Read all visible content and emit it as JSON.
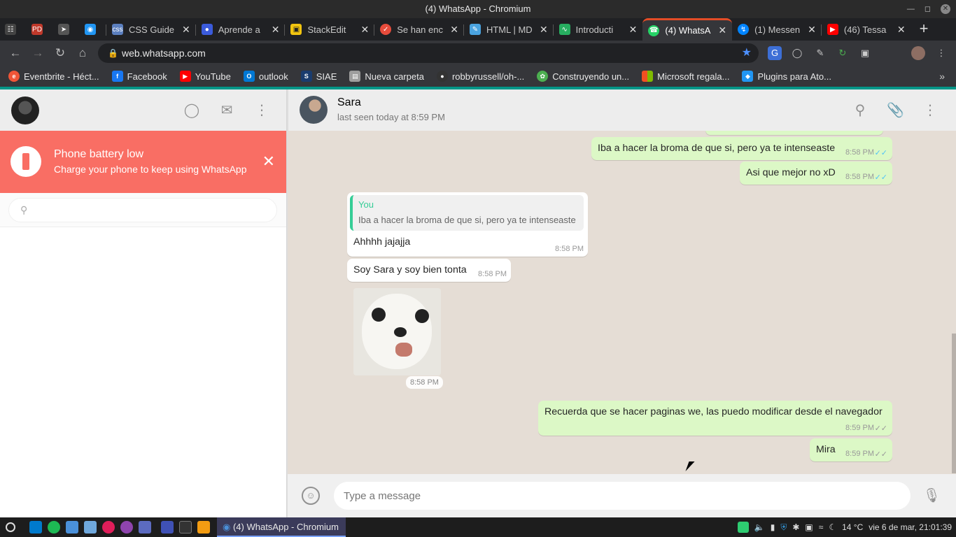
{
  "window": {
    "title": "(4) WhatsApp - Chromium"
  },
  "tabs": [
    {
      "label": "",
      "icon": "library-icon",
      "color": "#444444",
      "pinned": true
    },
    {
      "label": "",
      "icon": "pd-icon",
      "color": "#c0392b",
      "pinned": true
    },
    {
      "label": "",
      "icon": "telegram-icon",
      "color": "#555555",
      "pinned": true
    },
    {
      "label": "",
      "icon": "drop-icon",
      "color": "#2196f3",
      "pinned": true
    },
    {
      "label": "CSS Guide",
      "icon": "css-icon",
      "color": "#5b7fbf"
    },
    {
      "label": "Aprende a",
      "icon": "person-icon",
      "color": "#3b5bdb"
    },
    {
      "label": "StackEdit",
      "icon": "stackedit-icon",
      "color": "#f1c40f"
    },
    {
      "label": "Se han enc",
      "icon": "check-icon",
      "color": "#e74c3c"
    },
    {
      "label": "HTML | MD",
      "icon": "book-icon",
      "color": "#4aa3df"
    },
    {
      "label": "Introducti",
      "icon": "wave-icon",
      "color": "#27ae60"
    },
    {
      "label": "(4) WhatsA",
      "icon": "whatsapp-icon",
      "color": "#25d366",
      "active": true
    },
    {
      "label": "(1) Messen",
      "icon": "messenger-icon",
      "color": "#0084ff"
    },
    {
      "label": "(46) Tessa",
      "icon": "youtube-icon",
      "color": "#ff0000"
    }
  ],
  "address": {
    "url": "web.whatsapp.com"
  },
  "bookmarks": [
    {
      "label": "Eventbrite - Héct...",
      "icon": "eventbrite-icon",
      "color": "#f05537"
    },
    {
      "label": "Facebook",
      "icon": "facebook-icon",
      "color": "#1877f2"
    },
    {
      "label": "YouTube",
      "icon": "youtube-icon",
      "color": "#ff0000"
    },
    {
      "label": "outlook",
      "icon": "outlook-icon",
      "color": "#0078d4"
    },
    {
      "label": "SIAE",
      "icon": "siae-icon",
      "color": "#1a3c6e"
    },
    {
      "label": "Nueva carpeta",
      "icon": "folder-icon",
      "color": "#9e9e9e"
    },
    {
      "label": "robbyrussell/oh-...",
      "icon": "github-icon",
      "color": "#333333"
    },
    {
      "label": "Construyendo un...",
      "icon": "leaf-icon",
      "color": "#4caf50"
    },
    {
      "label": "Microsoft regala...",
      "icon": "microsoft-icon",
      "color": "#f25022"
    },
    {
      "label": "Plugins para Ato...",
      "icon": "plugin-icon",
      "color": "#2196f3"
    }
  ],
  "sidebar": {
    "battery": {
      "title": "Phone battery low",
      "subtitle": "Charge your phone to keep using WhatsApp"
    },
    "search": {
      "placeholder": ""
    }
  },
  "chat": {
    "contact": {
      "name": "Sara",
      "status": "last seen today at 8:59 PM"
    },
    "messages": [
      {
        "dir": "out",
        "text": "Iba a hacer la broma de que si, pero ya te intenseaste",
        "time": "8:58 PM",
        "read": true
      },
      {
        "dir": "out",
        "text": "Asi que mejor no xD",
        "time": "8:58 PM",
        "read": true
      },
      {
        "dir": "in",
        "quote_author": "You",
        "quote_text": "Iba a hacer la broma de que si, pero ya te intenseaste",
        "text": "Ahhhh jajajja",
        "time": "8:58 PM"
      },
      {
        "dir": "in",
        "text": "Soy Sara y soy bien tonta",
        "time": "8:58 PM"
      },
      {
        "dir": "in",
        "type": "sticker",
        "time": "8:58 PM"
      },
      {
        "dir": "out",
        "text": "Recuerda que se hacer paginas we, las puedo modificar desde el navegador",
        "time": "8:59 PM",
        "read": false
      },
      {
        "dir": "out",
        "text": "Mira",
        "time": "8:59 PM",
        "read": false
      }
    ],
    "composer": {
      "placeholder": "Type a message"
    }
  },
  "taskbar": {
    "active_task": "(4) WhatsApp - Chromium",
    "temperature": "14 °C",
    "clock": "vie 6 de mar, 21:01:39"
  },
  "colors": {
    "accent": "#009688",
    "outgoing_bubble": "#dcf8c6",
    "battery_banner": "#f96e64",
    "read_ticks": "#4fc3f7"
  }
}
